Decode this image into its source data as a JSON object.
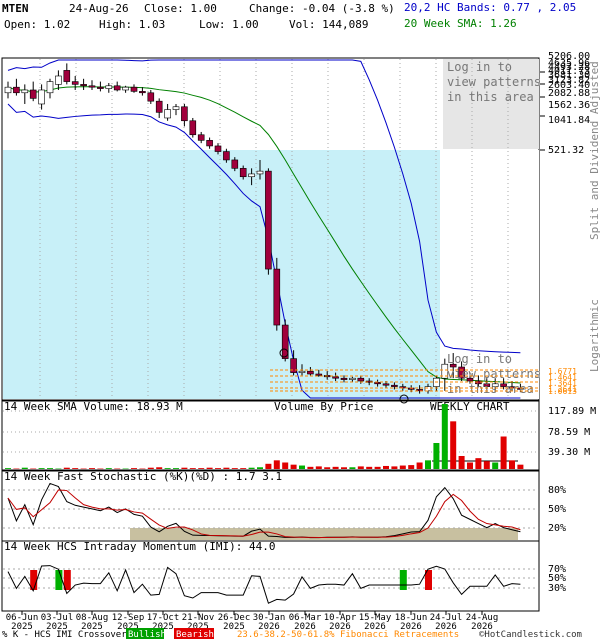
{
  "header": {
    "symbol": "MTEN",
    "date": "24-Aug-26",
    "close": "Close: 1.00",
    "change": "Change: -0.04 (-3.8 %)",
    "bands": "20,2 HC Bands: 0.77 , 2.05",
    "open": "Open: 1.02",
    "high": "High: 1.03",
    "low": "Low: 1.00",
    "vol": "Vol: 144,089",
    "sma": "20 Week SMA: 1.26"
  },
  "labels": {
    "login_top": [
      "Log in to",
      "view patterns",
      "in this area"
    ],
    "login_mid": [
      "Log in to",
      "view patterns",
      "in this area"
    ],
    "split_note": "Split and Dividend Adjusted",
    "log_note": "Logarithmic",
    "vol_title": "14 Week SMA Volume: 18.93 M",
    "vbp": "Volume By Price",
    "weekly": "WEEKLY CHART",
    "stoch_title": "14 Week Fast Stochastic (%K)(%D) : 1.7   3.1",
    "imi_title": "14 Week HCS Intraday Momentum (IMI): 44.0",
    "legend_prefix": "% K - HCS IMI Crossover:",
    "bullish": "Bullish",
    "bearish": "Bearish",
    "fib": "23.6-38.2-50-61.8% Fibonacci Retracements",
    "copyright": "©HotCandlestick.com"
  },
  "colors": {
    "up": "#ffffff",
    "down": "#a0003c",
    "blue_band": "#0000c8",
    "green_sma": "#008000",
    "cyan_zone": "#c8f0f8",
    "vol_green": "#00b000",
    "vol_red": "#e00000",
    "fib": "#ff8800",
    "stoch_k": "#000000",
    "stoch_d": "#c00000",
    "khaki": "#c8c0a0"
  },
  "chart_data": {
    "type": "candlestick",
    "price_axis_labels": [
      "5206.00",
      "4635.96",
      "4493.28",
      "4011.73",
      "3681.30",
      "3123.82",
      "2603.40",
      "2082.88",
      "1562.36",
      "1041.84",
      "521.32",
      "1.6771",
      "1.4641",
      "1.3641",
      "1.2641",
      "1.0613"
    ],
    "x_tick_labels": [
      [
        "06-Jun",
        "2025"
      ],
      [
        "03-Jul",
        "2025"
      ],
      [
        "08-Aug",
        "2025"
      ],
      [
        "12-Sep",
        "2025"
      ],
      [
        "17-Oct",
        "2025"
      ],
      [
        "21-Nov",
        "2025"
      ],
      [
        "26-Dec",
        "2025"
      ],
      [
        "30-Jan",
        "2026"
      ],
      [
        "06-Mar",
        "2026"
      ],
      [
        "10-Apr",
        "2026"
      ],
      [
        "15-May",
        "2026"
      ],
      [
        "18-Jun",
        "2026"
      ],
      [
        "24-Jul",
        "2026"
      ],
      [
        "24-Aug",
        "2026"
      ]
    ],
    "candles": [
      {
        "o": 0.52,
        "h": 0.56,
        "l": 0.5,
        "c": 0.54
      },
      {
        "o": 0.54,
        "h": 0.57,
        "l": 0.51,
        "c": 0.52
      },
      {
        "o": 0.52,
        "h": 0.55,
        "l": 0.48,
        "c": 0.53
      },
      {
        "o": 0.53,
        "h": 0.56,
        "l": 0.49,
        "c": 0.5
      },
      {
        "o": 0.48,
        "h": 0.55,
        "l": 0.46,
        "c": 0.53
      },
      {
        "o": 0.52,
        "h": 0.57,
        "l": 0.5,
        "c": 0.56
      },
      {
        "o": 0.55,
        "h": 0.6,
        "l": 0.53,
        "c": 0.58
      },
      {
        "o": 0.6,
        "h": 0.625,
        "l": 0.55,
        "c": 0.56
      },
      {
        "o": 0.56,
        "h": 0.58,
        "l": 0.53,
        "c": 0.55
      },
      {
        "o": 0.55,
        "h": 0.57,
        "l": 0.53,
        "c": 0.545
      },
      {
        "o": 0.545,
        "h": 0.565,
        "l": 0.53,
        "c": 0.54
      },
      {
        "o": 0.54,
        "h": 0.56,
        "l": 0.525,
        "c": 0.535
      },
      {
        "o": 0.535,
        "h": 0.555,
        "l": 0.52,
        "c": 0.545
      },
      {
        "o": 0.545,
        "h": 0.56,
        "l": 0.525,
        "c": 0.53
      },
      {
        "o": 0.53,
        "h": 0.545,
        "l": 0.52,
        "c": 0.54
      },
      {
        "o": 0.54,
        "h": 0.55,
        "l": 0.52,
        "c": 0.525
      },
      {
        "o": 0.525,
        "h": 0.54,
        "l": 0.51,
        "c": 0.52
      },
      {
        "o": 0.52,
        "h": 0.53,
        "l": 0.48,
        "c": 0.49
      },
      {
        "o": 0.49,
        "h": 0.5,
        "l": 0.43,
        "c": 0.45
      },
      {
        "o": 0.43,
        "h": 0.48,
        "l": 0.42,
        "c": 0.46
      },
      {
        "o": 0.46,
        "h": 0.48,
        "l": 0.44,
        "c": 0.47
      },
      {
        "o": 0.47,
        "h": 0.48,
        "l": 0.4,
        "c": 0.42
      },
      {
        "o": 0.42,
        "h": 0.43,
        "l": 0.36,
        "c": 0.37
      },
      {
        "o": 0.37,
        "h": 0.38,
        "l": 0.34,
        "c": 0.35
      },
      {
        "o": 0.35,
        "h": 0.36,
        "l": 0.32,
        "c": 0.33
      },
      {
        "o": 0.33,
        "h": 0.34,
        "l": 0.3,
        "c": 0.31
      },
      {
        "o": 0.31,
        "h": 0.32,
        "l": 0.27,
        "c": 0.28
      },
      {
        "o": 0.28,
        "h": 0.29,
        "l": 0.24,
        "c": 0.25
      },
      {
        "o": 0.25,
        "h": 0.26,
        "l": 0.21,
        "c": 0.22
      },
      {
        "o": 0.22,
        "h": 0.25,
        "l": 0.19,
        "c": 0.23
      },
      {
        "o": 0.23,
        "h": 0.28,
        "l": 0.21,
        "c": 0.24
      },
      {
        "o": 0.24,
        "h": 0.25,
        "l": -0.13,
        "c": -0.11
      },
      {
        "o": -0.11,
        "h": -0.07,
        "l": -0.33,
        "c": -0.31
      },
      {
        "o": -0.31,
        "h": -0.29,
        "l": -0.44,
        "c": -0.43
      },
      {
        "o": -0.43,
        "h": -0.4,
        "l": -0.49,
        "c": -0.48
      },
      {
        "o": -0.48,
        "h": -0.45,
        "l": -0.49,
        "c": -0.475
      },
      {
        "o": -0.475,
        "h": -0.46,
        "l": -0.49,
        "c": -0.485
      },
      {
        "o": -0.485,
        "h": -0.47,
        "l": -0.495,
        "c": -0.49
      },
      {
        "o": -0.49,
        "h": -0.475,
        "l": -0.505,
        "c": -0.495
      },
      {
        "o": -0.495,
        "h": -0.48,
        "l": -0.51,
        "c": -0.5
      },
      {
        "o": -0.5,
        "h": -0.49,
        "l": -0.515,
        "c": -0.505
      },
      {
        "o": -0.505,
        "h": -0.495,
        "l": -0.515,
        "c": -0.5
      },
      {
        "o": -0.5,
        "h": -0.49,
        "l": -0.52,
        "c": -0.51
      },
      {
        "o": -0.51,
        "h": -0.5,
        "l": -0.525,
        "c": -0.515
      },
      {
        "o": -0.515,
        "h": -0.505,
        "l": -0.53,
        "c": -0.52
      },
      {
        "o": -0.52,
        "h": -0.51,
        "l": -0.535,
        "c": -0.525
      },
      {
        "o": -0.525,
        "h": -0.515,
        "l": -0.54,
        "c": -0.53
      },
      {
        "o": -0.53,
        "h": -0.52,
        "l": -0.545,
        "c": -0.535
      },
      {
        "o": -0.535,
        "h": -0.525,
        "l": -0.55,
        "c": -0.54
      },
      {
        "o": -0.54,
        "h": -0.525,
        "l": -0.555,
        "c": -0.545
      },
      {
        "o": -0.545,
        "h": -0.52,
        "l": -0.555,
        "c": -0.53
      },
      {
        "o": -0.53,
        "h": -0.49,
        "l": -0.545,
        "c": -0.5
      },
      {
        "o": -0.5,
        "h": -0.43,
        "l": -0.545,
        "c": -0.45
      },
      {
        "o": -0.45,
        "h": -0.41,
        "l": -0.5,
        "c": -0.46
      },
      {
        "o": -0.46,
        "h": -0.44,
        "l": -0.51,
        "c": -0.5
      },
      {
        "o": -0.5,
        "h": -0.48,
        "l": -0.52,
        "c": -0.51
      },
      {
        "o": -0.51,
        "h": -0.49,
        "l": -0.53,
        "c": -0.52
      },
      {
        "o": -0.52,
        "h": -0.5,
        "l": -0.54,
        "c": -0.53
      },
      {
        "o": -0.53,
        "h": -0.5,
        "l": -0.55,
        "c": -0.52
      },
      {
        "o": -0.52,
        "h": -0.5,
        "l": -0.54,
        "c": -0.53
      },
      {
        "o": -0.53,
        "h": -0.51,
        "l": -0.545,
        "c": -0.535
      },
      {
        "o": -0.535,
        "h": -0.52,
        "l": -0.55,
        "c": -0.54
      }
    ],
    "volume": [
      0.2,
      0.1,
      0.3,
      0.1,
      0.2,
      0.2,
      0.1,
      0.3,
      0.2,
      0.1,
      0.2,
      0.1,
      0.2,
      0.1,
      0.1,
      0.2,
      0.1,
      0.3,
      0.4,
      0.2,
      0.2,
      0.3,
      0.2,
      0.2,
      0.3,
      0.2,
      0.3,
      0.2,
      0.2,
      0.3,
      0.4,
      1.2,
      2.0,
      1.5,
      1.0,
      0.8,
      0.5,
      0.6,
      0.4,
      0.5,
      0.4,
      0.4,
      0.6,
      0.5,
      0.5,
      0.7,
      0.6,
      0.8,
      0.9,
      1.5,
      2.0,
      6.0,
      15.0,
      11.0,
      3.0,
      1.5,
      2.5,
      1.8,
      1.5,
      7.5,
      2.0,
      1.0
    ],
    "volume_axis_labels": [
      "117.89 M",
      "78.59 M",
      "39.30 M"
    ],
    "stoch_axis_labels": [
      "80%",
      "50%",
      "20%"
    ],
    "imi_axis_labels": [
      "70%",
      "50%",
      "30%"
    ]
  }
}
